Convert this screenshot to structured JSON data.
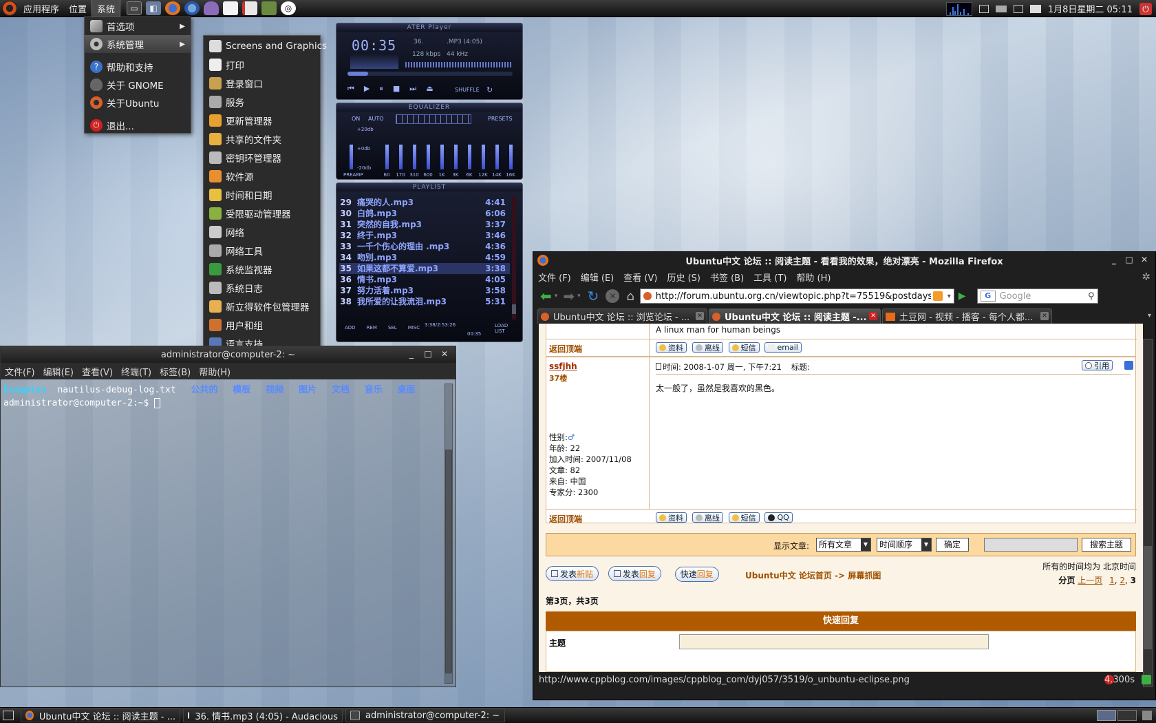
{
  "top_panel": {
    "menus": [
      "应用程序",
      "位置",
      "系统"
    ],
    "launchers": [
      "terminal-icon",
      "network-icon",
      "firefox-icon",
      "thunderbird-icon",
      "pidgin-icon",
      "text-editor-icon",
      "document-icon",
      "books-icon",
      "audacious-icon"
    ],
    "clock": "1月8日星期二 05:11"
  },
  "system_menu": {
    "items": [
      {
        "label": "首选项",
        "icon": "preferences-icon",
        "submenu": true
      },
      {
        "label": "系统管理",
        "icon": "gear-icon",
        "submenu": true
      },
      {
        "label": "帮助和支持",
        "icon": "help-icon"
      },
      {
        "label": "关于 GNOME",
        "icon": "gnome-foot-icon"
      },
      {
        "label": "关于Ubuntu",
        "icon": "ubuntu-icon"
      },
      {
        "label": "退出...",
        "icon": "power-icon"
      }
    ]
  },
  "admin_menu": {
    "items": [
      {
        "label": "Screens and Graphics",
        "icon": "monitor-icon"
      },
      {
        "label": "打印",
        "icon": "printer-icon"
      },
      {
        "label": "登录窗口",
        "icon": "login-window-icon"
      },
      {
        "label": "服务",
        "icon": "server-icon"
      },
      {
        "label": "更新管理器",
        "icon": "update-manager-icon"
      },
      {
        "label": "共享的文件夹",
        "icon": "folder-icon"
      },
      {
        "label": "密钥环管理器",
        "icon": "key-icon"
      },
      {
        "label": "软件源",
        "icon": "software-sources-icon"
      },
      {
        "label": "时间和日期",
        "icon": "clock-icon"
      },
      {
        "label": "受限驱动管理器",
        "icon": "chip-icon"
      },
      {
        "label": "网络",
        "icon": "network-icon"
      },
      {
        "label": "网络工具",
        "icon": "network-tools-icon"
      },
      {
        "label": "系统监视器",
        "icon": "system-monitor-icon"
      },
      {
        "label": "系统日志",
        "icon": "log-icon"
      },
      {
        "label": "新立得软件包管理器",
        "icon": "package-icon"
      },
      {
        "label": "用户和组",
        "icon": "users-icon"
      },
      {
        "label": "语言支持",
        "icon": "flag-icon"
      }
    ]
  },
  "audacious": {
    "title": "ATER Player",
    "time": "00:35",
    "track_no": "36.",
    "track_info": ".MP3 (4:05)",
    "bitrate": "128 kbps",
    "samplerate": "44 kHz",
    "shuffle_label": "SHUFFLE",
    "eq_title": "EQUALIZER",
    "eq_on": "ON",
    "eq_auto": "AUTO",
    "eq_presets": "PRESETS",
    "eq_levels": [
      "+20db",
      "+0db",
      "-20db"
    ],
    "eq_bands": [
      "PREAMP",
      "60",
      "170",
      "310",
      "600",
      "1K",
      "3K",
      "6K",
      "12K",
      "14K",
      "16K"
    ],
    "playlist_title": "PLAYLIST",
    "playlist": [
      {
        "n": "29",
        "title": "痛哭的人.mp3",
        "dur": "4:41"
      },
      {
        "n": "30",
        "title": "白鸽.mp3",
        "dur": "6:06"
      },
      {
        "n": "31",
        "title": "突然的自我.mp3",
        "dur": "3:37"
      },
      {
        "n": "32",
        "title": "终于.mp3",
        "dur": "3:46"
      },
      {
        "n": "33",
        "title": "一千个伤心的理由 .mp3",
        "dur": "4:36"
      },
      {
        "n": "34",
        "title": "吻别.mp3",
        "dur": "4:59"
      },
      {
        "n": "35",
        "title": "如果这都不算爱.mp3",
        "dur": "3:38"
      },
      {
        "n": "36",
        "title": "情书.mp3",
        "dur": "4:05"
      },
      {
        "n": "37",
        "title": "努力活着.mp3",
        "dur": "3:58"
      },
      {
        "n": "38",
        "title": "我所爱的让我流泪.mp3",
        "dur": "5:31"
      }
    ],
    "pl_buttons": [
      "ADD",
      "REM",
      "SEL",
      "MISC"
    ],
    "pl_stats": "3:38/2:53:26",
    "pl_time": "00:35",
    "pl_load": "LOAD LIST"
  },
  "terminal": {
    "title": "administrator@computer-2: ~",
    "menus": [
      "文件(F)",
      "编辑(E)",
      "查看(V)",
      "终端(T)",
      "标签(B)",
      "帮助(H)"
    ],
    "ls_output": [
      "Examples",
      "nautilus-debug-log.txt",
      "公共的",
      "模板",
      "视频",
      "图片",
      "文档",
      "音乐",
      "桌面"
    ],
    "prompt": "administrator@computer-2:~$"
  },
  "firefox": {
    "title": "Ubuntu中文 论坛 :: 阅读主题 - 看看我的效果，绝对漂亮 - Mozilla Firefox",
    "menus": [
      "文件 (F)",
      "编辑 (E)",
      "查看 (V)",
      "历史 (S)",
      "书签 (B)",
      "工具 (T)",
      "帮助 (H)"
    ],
    "url": "http://forum.ubuntu.org.cn/viewtopic.php?t=75519&postdays",
    "search_placeholder": "Google",
    "tabs": [
      "Ubuntu中文 论坛 :: 浏览论坛 - ...",
      "Ubuntu中文 论坛 :: 阅读主题 -...",
      "土豆网 - 视频 - 播客 - 每个人都..."
    ],
    "top_signature": "A linux man for human beings",
    "back_to_top": "返回顶端",
    "buttons1": [
      "资料",
      "离线",
      "短信",
      "email"
    ],
    "post": {
      "author": "ssfjhh",
      "floor": "37楼",
      "time": "时间: 2008-1-07 周一, 下午7:21",
      "subject_label": "标题:",
      "quote": "引用",
      "body": "太一般了，虽然是我喜欢的黑色。",
      "gender_label": "性别:",
      "age": "年龄: 22",
      "joined": "加入时间: 2007/11/08",
      "posts": "文章: 82",
      "from": "来自: 中国",
      "score": "专家分: 2300"
    },
    "buttons2": [
      "资料",
      "离线",
      "短信",
      "QQ"
    ],
    "show_posts_label": "显示文章:",
    "show_posts_value": "所有文章",
    "order_value": "时间顺序",
    "confirm": "确定",
    "search_topic": "搜索主题",
    "new_topic": [
      "发表",
      "新贴"
    ],
    "reply": [
      "发表",
      "回复"
    ],
    "quick_reply_btn": [
      "快速",
      "回复"
    ],
    "breadcrumb_home": "Ubuntu中文 论坛首页",
    "breadcrumb_sep": "->",
    "breadcrumb_forum": "屏幕抓图",
    "timezone": "所有的时间均为 北京时间",
    "pagination_label": "分页",
    "prev_page": "上一页",
    "pages": [
      "1",
      "2",
      "3"
    ],
    "page_info": "第3页，共3页",
    "quick_reply_title": "快速回复",
    "subject": "主题",
    "status_url": "http://www.cppblog.com/images/cppblog_com/dyj057/3519/o_unbuntu-eclipse.png",
    "load_time": "4.300s"
  },
  "taskbar": [
    {
      "label": "Ubuntu中文 论坛 :: 阅读主题 - ...",
      "icon": "firefox-icon"
    },
    {
      "label": "36. 情书.mp3 (4:05) - Audacious",
      "icon": "audacious-icon"
    },
    {
      "label": "administrator@computer-2: ~",
      "icon": "terminal-icon"
    }
  ]
}
